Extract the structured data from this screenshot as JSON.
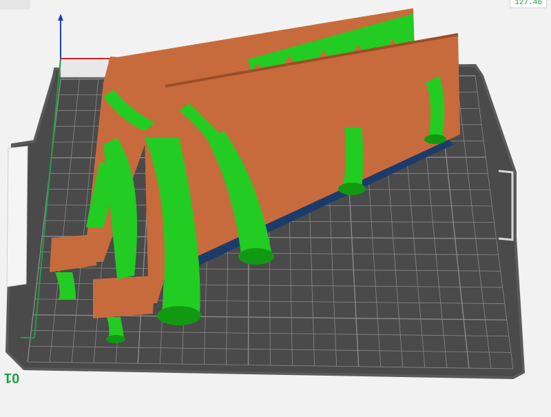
{
  "viewport": {
    "coordinate_readout": "127.46",
    "bed_label": "01",
    "colors": {
      "background": "#f2f2f2",
      "bed_plate": "#4a4a4a",
      "bed_edge": "#5a5a5a",
      "grid_line": "#8a8a8a",
      "model": "#c86b3c",
      "model_dark": "#9b4e28",
      "support": "#22cc22",
      "support_dark": "#129912",
      "base_shadow": "#1b3b6b",
      "axis_x": "#d22222",
      "axis_y": "#1f9e4a",
      "axis_z": "#1c3fbf",
      "text_accent": "#1f9e4a"
    },
    "icons": [
      "axis-gizmo-icon",
      "bed-handle-icon"
    ]
  }
}
